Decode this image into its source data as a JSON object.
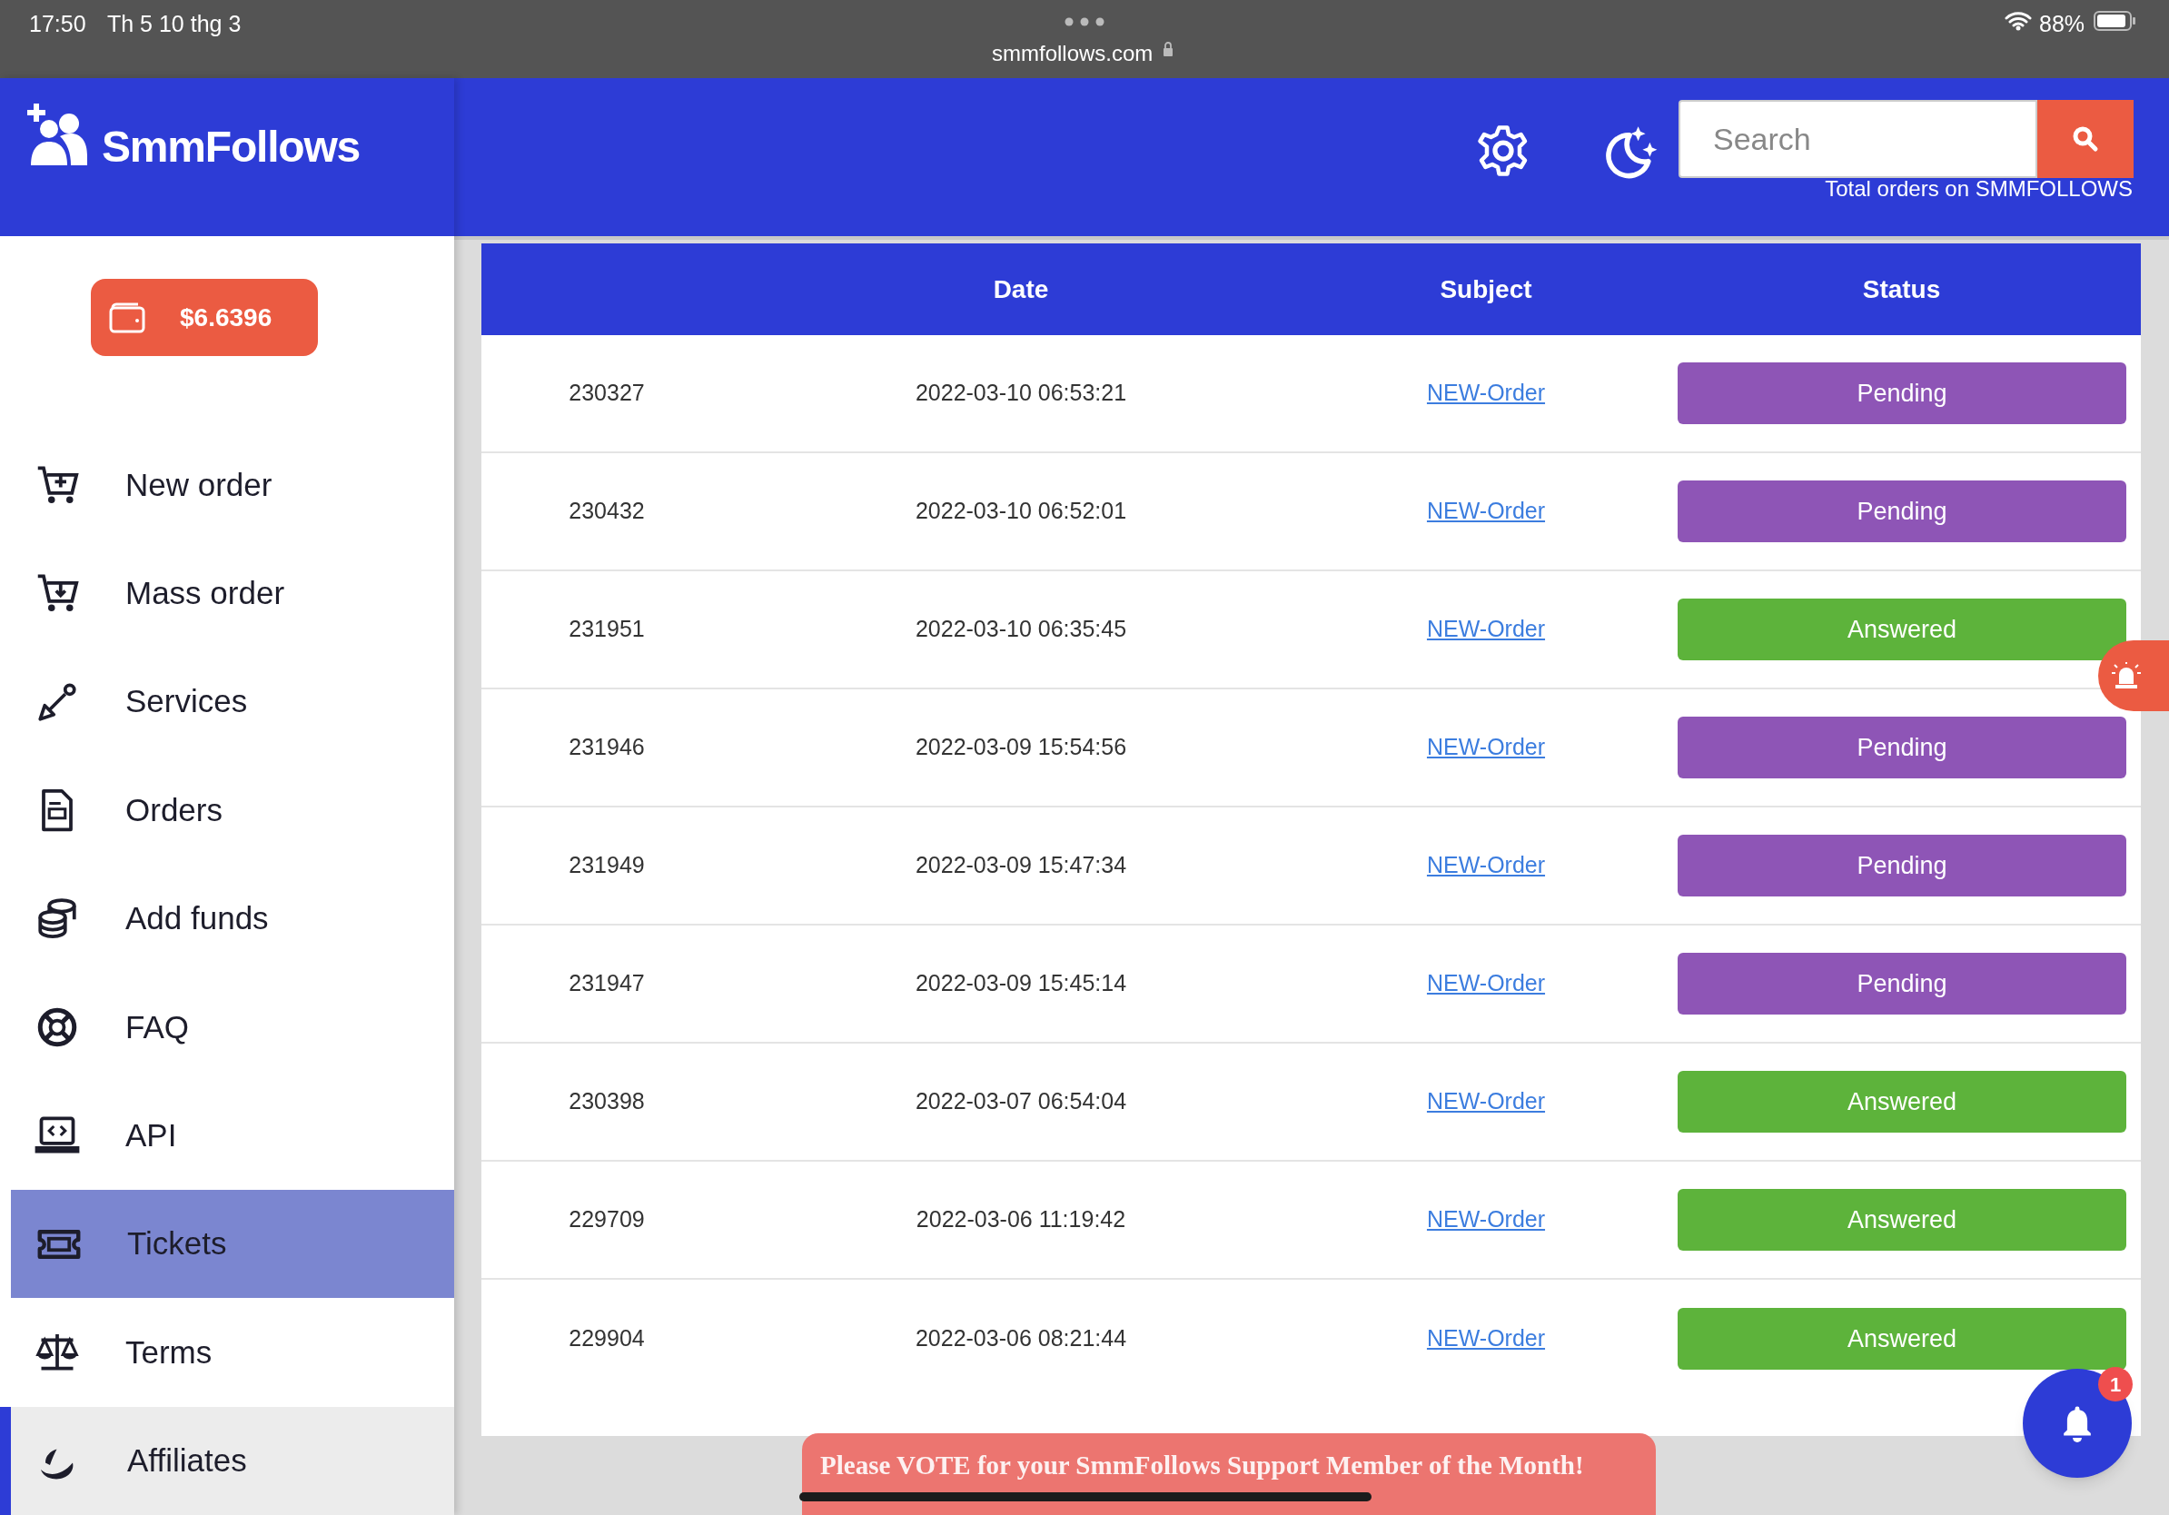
{
  "status_bar": {
    "time": "17:50",
    "date": "Th 5 10 thg 3",
    "url": "smmfollows.com",
    "battery": "88%"
  },
  "brand": {
    "name": "SmmFollows"
  },
  "balance": {
    "amount": "$6.6396"
  },
  "sidebar": {
    "items": [
      {
        "label": "New order",
        "selected": false,
        "hovered": false
      },
      {
        "label": "Mass order",
        "selected": false,
        "hovered": false
      },
      {
        "label": "Services",
        "selected": false,
        "hovered": false
      },
      {
        "label": "Orders",
        "selected": false,
        "hovered": false
      },
      {
        "label": "Add funds",
        "selected": false,
        "hovered": false
      },
      {
        "label": "FAQ",
        "selected": false,
        "hovered": false
      },
      {
        "label": "API",
        "selected": false,
        "hovered": false
      },
      {
        "label": "Tickets",
        "selected": true,
        "hovered": false
      },
      {
        "label": "Terms",
        "selected": false,
        "hovered": false
      },
      {
        "label": "Affiliates",
        "selected": false,
        "hovered": true
      }
    ]
  },
  "header": {
    "search": {
      "placeholder": "Search"
    },
    "total_orders": "Total orders on SMMFOLLOWS"
  },
  "table": {
    "columns": [
      "Date",
      "Subject",
      "Status"
    ],
    "rows": [
      {
        "id": "230327",
        "date": "2022-03-10 06:53:21",
        "subject": "NEW-Order",
        "status": {
          "label": "Pending",
          "kind": "pending"
        }
      },
      {
        "id": "230432",
        "date": "2022-03-10 06:52:01",
        "subject": "NEW-Order",
        "status": {
          "label": "Pending",
          "kind": "pending"
        }
      },
      {
        "id": "231951",
        "date": "2022-03-10 06:35:45",
        "subject": "NEW-Order",
        "status": {
          "label": "Answered",
          "kind": "answered"
        }
      },
      {
        "id": "231946",
        "date": "2022-03-09 15:54:56",
        "subject": "NEW-Order",
        "status": {
          "label": "Pending",
          "kind": "pending"
        }
      },
      {
        "id": "231949",
        "date": "2022-03-09 15:47:34",
        "subject": "NEW-Order",
        "status": {
          "label": "Pending",
          "kind": "pending"
        }
      },
      {
        "id": "231947",
        "date": "2022-03-09 15:45:14",
        "subject": "NEW-Order",
        "status": {
          "label": "Pending",
          "kind": "pending"
        }
      },
      {
        "id": "230398",
        "date": "2022-03-07 06:54:04",
        "subject": "NEW-Order",
        "status": {
          "label": "Answered",
          "kind": "answered"
        }
      },
      {
        "id": "229709",
        "date": "2022-03-06 11:19:42",
        "subject": "NEW-Order",
        "status": {
          "label": "Answered",
          "kind": "answered"
        }
      },
      {
        "id": "229904",
        "date": "2022-03-06 08:21:44",
        "subject": "NEW-Order",
        "status": {
          "label": "Answered",
          "kind": "answered"
        }
      }
    ]
  },
  "banner": {
    "text": "Please VOTE for your SmmFollows Support Member of the Month!"
  },
  "notifications": {
    "badge": "1"
  }
}
